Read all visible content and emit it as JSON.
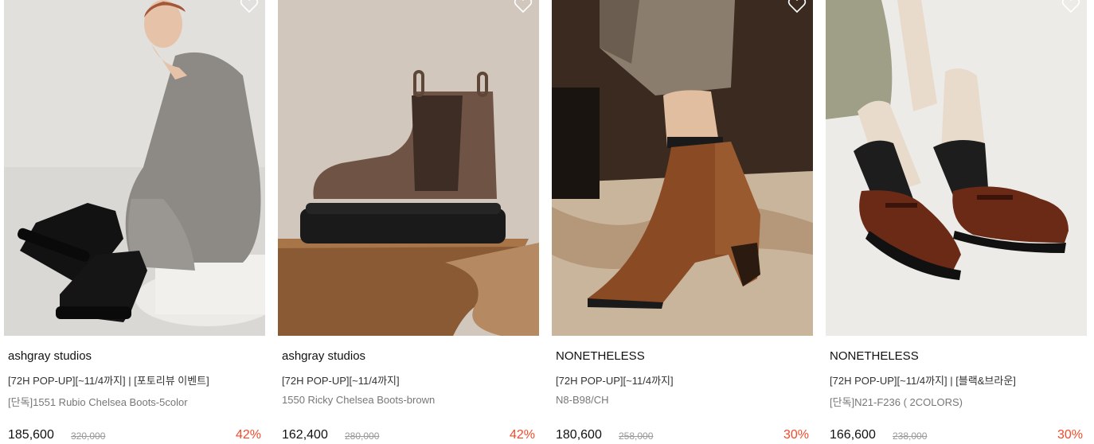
{
  "products": [
    {
      "brand": "ashgray studios",
      "promo": "[72H POP-UP][~11/4까지] | [포토리뷰 이벤트]",
      "name": "[단독]1551 Rubio Chelsea Boots-5color",
      "price": "185,600",
      "original_price": "320,000",
      "discount": "42%",
      "image": "woman-sitting-black-chelsea-boots-photo"
    },
    {
      "brand": "ashgray studios",
      "promo": "[72H POP-UP][~11/4까지]",
      "name": "1550 Ricky Chelsea Boots-brown",
      "price": "162,400",
      "original_price": "280,000",
      "discount": "42%",
      "image": "brown-chelsea-boot-on-pedestal-photo"
    },
    {
      "brand": "NONETHELESS",
      "promo": "[72H POP-UP][~11/4까지]",
      "name": "N8-B98/CH",
      "price": "180,600",
      "original_price": "258,000",
      "discount": "30%",
      "image": "brown-leather-suede-ankle-boot-photo"
    },
    {
      "brand": "NONETHELESS",
      "promo": "[72H POP-UP][~11/4까지] | [블랙&브라운]",
      "name": "[단독]N21-F236 ( 2COLORS)",
      "price": "166,600",
      "original_price": "238,000",
      "discount": "30%",
      "image": "brown-mary-jane-shoes-photo"
    }
  ],
  "colors": {
    "discount": "#f04a2a",
    "original_price": "#999999",
    "wishlist_icon": "#ffffff"
  },
  "icons": {
    "wishlist": "heart-outline-icon"
  }
}
